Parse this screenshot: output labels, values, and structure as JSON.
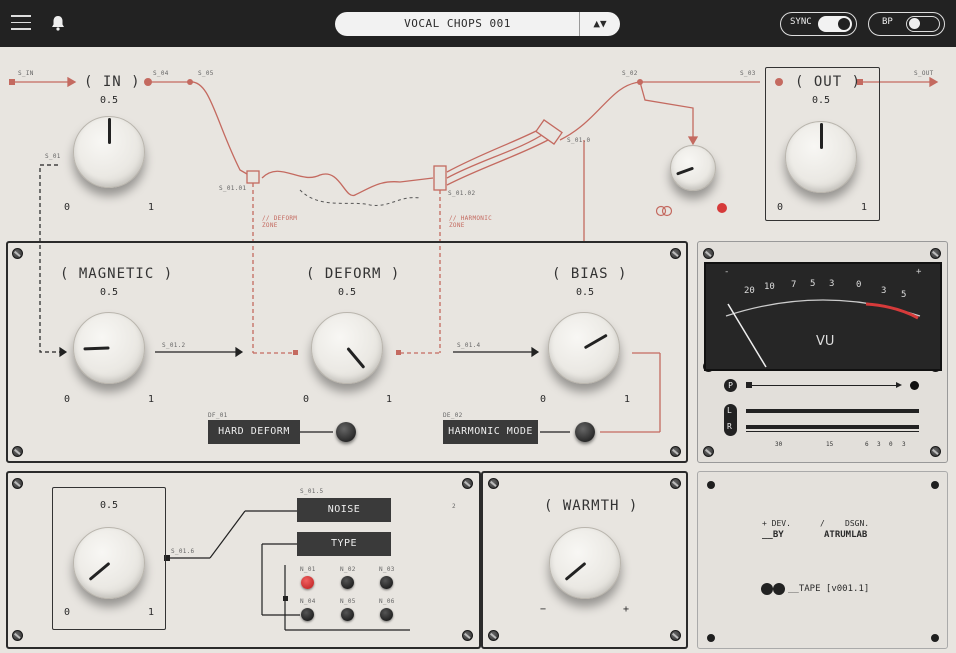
{
  "header": {
    "preset_name": "VOCAL CHOPS 001",
    "arrows": "▲▼",
    "sync_label": "SYNC",
    "bp_label": "BP"
  },
  "io": {
    "in_label": "( IN )",
    "out_label": "( OUT )",
    "in_value": "0.5",
    "out_value": "0.5",
    "min": "0",
    "max": "1"
  },
  "signal": {
    "s_in": "S_IN",
    "s_04": "S_04",
    "s_05": "S_05",
    "s_01": "S_01",
    "s_02": "S_02",
    "s_03": "S_03",
    "s_out": "S_OUT",
    "s_01_01": "S_01.01",
    "s_01_02": "S_01.02",
    "s_01_0": "S_01.0",
    "deform_zone": "// DEFORM ZONE",
    "harmonic_zone": "// HARMONIC ZONE",
    "s_01_2": "S_01.2",
    "s_01_4": "S_01.4",
    "s_01_5": "S_01.5",
    "s_01_6": "S_01.6",
    "tape_num": "2"
  },
  "magnetic": {
    "label": "( MAGNETIC )",
    "value": "0.5"
  },
  "deform": {
    "label": "( DEFORM )",
    "value": "0.5",
    "button": "HARD DEFORM",
    "code": "DF_01"
  },
  "bias": {
    "label": "( BIAS )",
    "value": "0.5",
    "button": "HARMONIC MODE",
    "code": "DE_02"
  },
  "noise": {
    "value": "0.5",
    "noise_button": "NOISE",
    "type_button": "TYPE",
    "types": [
      "N_01",
      "N_02",
      "N_03",
      "N_04",
      "N_05",
      "N_06"
    ]
  },
  "warmth": {
    "label": "( WARMTH )",
    "minus": "−",
    "plus": "+"
  },
  "vu": {
    "scale": [
      "20",
      "10",
      "7",
      "5",
      "3",
      "0",
      "3",
      "5"
    ],
    "minus": "-",
    "plus": "+",
    "label": "VU",
    "p": "P",
    "l": "L",
    "r": "R",
    "ticks": [
      "30",
      "15",
      "6",
      "3",
      "0",
      "3"
    ]
  },
  "credits": {
    "dev": "+ DEV.",
    "by": "__BY",
    "slash": "/",
    "dsgn": "DSGN.",
    "studio": "ATRUMLAB",
    "tape": "__TAPE [v001.1]"
  },
  "colors": {
    "accent_red": "#c46a60",
    "led_red": "#d63a3a",
    "panel": "#e8e5e0",
    "bar": "#222222"
  }
}
